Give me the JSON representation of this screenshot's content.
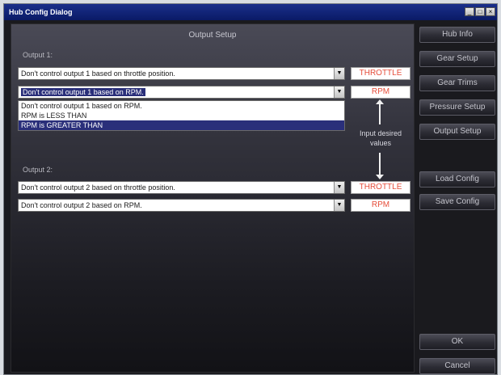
{
  "window": {
    "title": "Hub Config Dialog",
    "controls": {
      "minimize": "_",
      "maximize": "□",
      "close": "×"
    }
  },
  "main": {
    "title": "Output Setup",
    "output1": {
      "label": "Output 1:",
      "throttle_select": "Don't control output 1 based on throttle position.",
      "rpm_select": "Don't control output 1 based on RPM.",
      "rpm_options": [
        "Don't control output 1 based on RPM.",
        "RPM is LESS THAN",
        "RPM is GREATER THAN"
      ],
      "highlighted_option": "RPM is GREATER THAN",
      "throttle_tag": "THROTTLE",
      "rpm_tag": "RPM"
    },
    "hint": "Input desired values",
    "output2": {
      "label": "Output 2:",
      "throttle_select": "Don't control output 2 based on throttle position.",
      "rpm_select": "Don't control output 2 based on RPM.",
      "throttle_tag": "THROTTLE",
      "rpm_tag": "RPM"
    }
  },
  "sidebar": {
    "buttons": [
      "Hub Info",
      "Gear Setup",
      "Gear Trims",
      "Pressure Setup",
      "Output Setup",
      "Load Config",
      "Save Config"
    ],
    "ok": "OK",
    "cancel": "Cancel"
  },
  "colors": {
    "tag_text": "#e64d3a",
    "selection": "#2a2f7a",
    "title_bar": "#1a2f8a"
  }
}
